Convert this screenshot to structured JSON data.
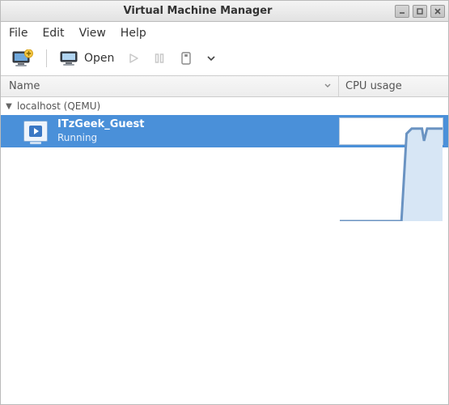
{
  "window": {
    "title": "Virtual Machine Manager"
  },
  "menubar": {
    "file": "File",
    "edit": "Edit",
    "view": "View",
    "help": "Help"
  },
  "toolbar": {
    "open_label": "Open"
  },
  "columns": {
    "name": "Name",
    "cpu": "CPU usage"
  },
  "tree": {
    "group_label": "localhost (QEMU)",
    "vm": {
      "name": "ITzGeek_Guest",
      "state": "Running"
    }
  },
  "chart_data": {
    "type": "area",
    "title": "CPU usage",
    "xlabel": "",
    "ylabel": "",
    "ylim": [
      0,
      100
    ],
    "x": [
      0,
      5,
      10,
      15,
      20,
      25,
      30,
      35,
      40,
      45,
      50,
      55,
      60,
      65,
      70,
      75,
      80,
      82,
      85,
      90,
      95,
      100
    ],
    "values": [
      0,
      0,
      0,
      0,
      0,
      0,
      0,
      0,
      0,
      0,
      0,
      0,
      0,
      85,
      90,
      90,
      90,
      78,
      90,
      90,
      90,
      90
    ]
  }
}
